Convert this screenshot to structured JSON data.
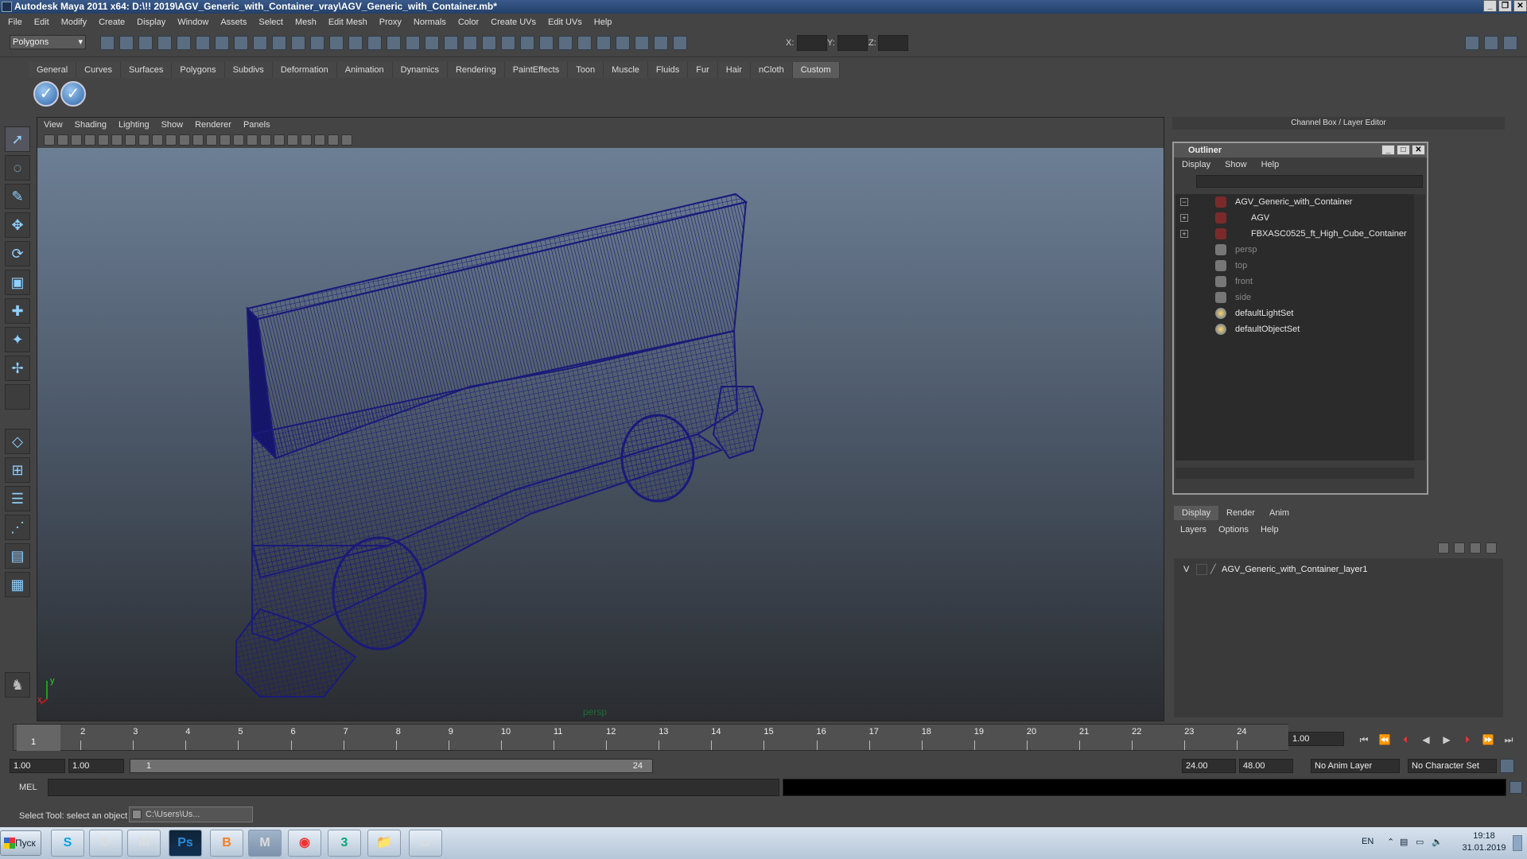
{
  "window": {
    "title": "Autodesk Maya 2011 x64: D:\\!! 2019\\AGV_Generic_with_Container_vray\\AGV_Generic_with_Container.mb*"
  },
  "menubar": [
    "File",
    "Edit",
    "Modify",
    "Create",
    "Display",
    "Window",
    "Assets",
    "Select",
    "Mesh",
    "Edit Mesh",
    "Proxy",
    "Normals",
    "Color",
    "Create UVs",
    "Edit UVs",
    "Help"
  ],
  "status": {
    "mode": "Polygons",
    "x_label": "X:",
    "y_label": "Y:",
    "z_label": "Z:"
  },
  "shelf": {
    "tabs": [
      "General",
      "Curves",
      "Surfaces",
      "Polygons",
      "Subdivs",
      "Deformation",
      "Animation",
      "Dynamics",
      "Rendering",
      "PaintEffects",
      "Toon",
      "Muscle",
      "Fluids",
      "Fur",
      "Hair",
      "nCloth",
      "Custom"
    ],
    "active_tab": "Custom"
  },
  "viewport": {
    "menu": [
      "View",
      "Shading",
      "Lighting",
      "Show",
      "Renderer",
      "Panels"
    ],
    "camera_label": "persp",
    "axis_y": "y",
    "axis_x": "x",
    "wire_color": "#1a1a7a"
  },
  "right_panel": {
    "header": "Channel Box / Layer Editor"
  },
  "outliner": {
    "title": "Outliner",
    "menu": [
      "Display",
      "Show",
      "Help"
    ],
    "items": [
      {
        "label": "AGV_Generic_with_Container",
        "expand": "−"
      },
      {
        "label": "AGV",
        "expand": "+"
      },
      {
        "label": "FBXASC0525_ft_High_Cube_Container",
        "expand": "+"
      },
      {
        "label": "persp"
      },
      {
        "label": "top"
      },
      {
        "label": "front"
      },
      {
        "label": "side"
      },
      {
        "label": "defaultLightSet"
      },
      {
        "label": "defaultObjectSet"
      }
    ]
  },
  "layer_editor": {
    "tabs": [
      "Display",
      "Render",
      "Anim"
    ],
    "menu": [
      "Layers",
      "Options",
      "Help"
    ],
    "layer": {
      "visible": "V",
      "name": "AGV_Generic_with_Container_layer1"
    }
  },
  "timeline": {
    "ticks": [
      "1",
      "2",
      "3",
      "4",
      "5",
      "6",
      "7",
      "8",
      "9",
      "10",
      "11",
      "12",
      "13",
      "14",
      "15",
      "16",
      "17",
      "18",
      "19",
      "20",
      "21",
      "22",
      "23",
      "24"
    ],
    "current_frame_marker": "1",
    "current_time": "1.00"
  },
  "range": {
    "start": "1.00",
    "playback_start": "1.00",
    "slider_start": "1",
    "slider_end": "24",
    "playback_end": "24.00",
    "end": "48.00",
    "anim_layer": "No Anim Layer",
    "character_set": "No Character Set"
  },
  "command": {
    "label": "MEL"
  },
  "statusbar": {
    "help": "Select Tool: select an object",
    "task_window": "C:\\Users\\Us..."
  },
  "taskbar": {
    "start": "Пуск",
    "apps": [
      "S",
      "⟳",
      "M",
      "Ps",
      "B",
      "M",
      "◉",
      "3",
      "📁",
      "▱"
    ],
    "lang": "EN",
    "time": "19:18",
    "date": "31.01.2019"
  }
}
